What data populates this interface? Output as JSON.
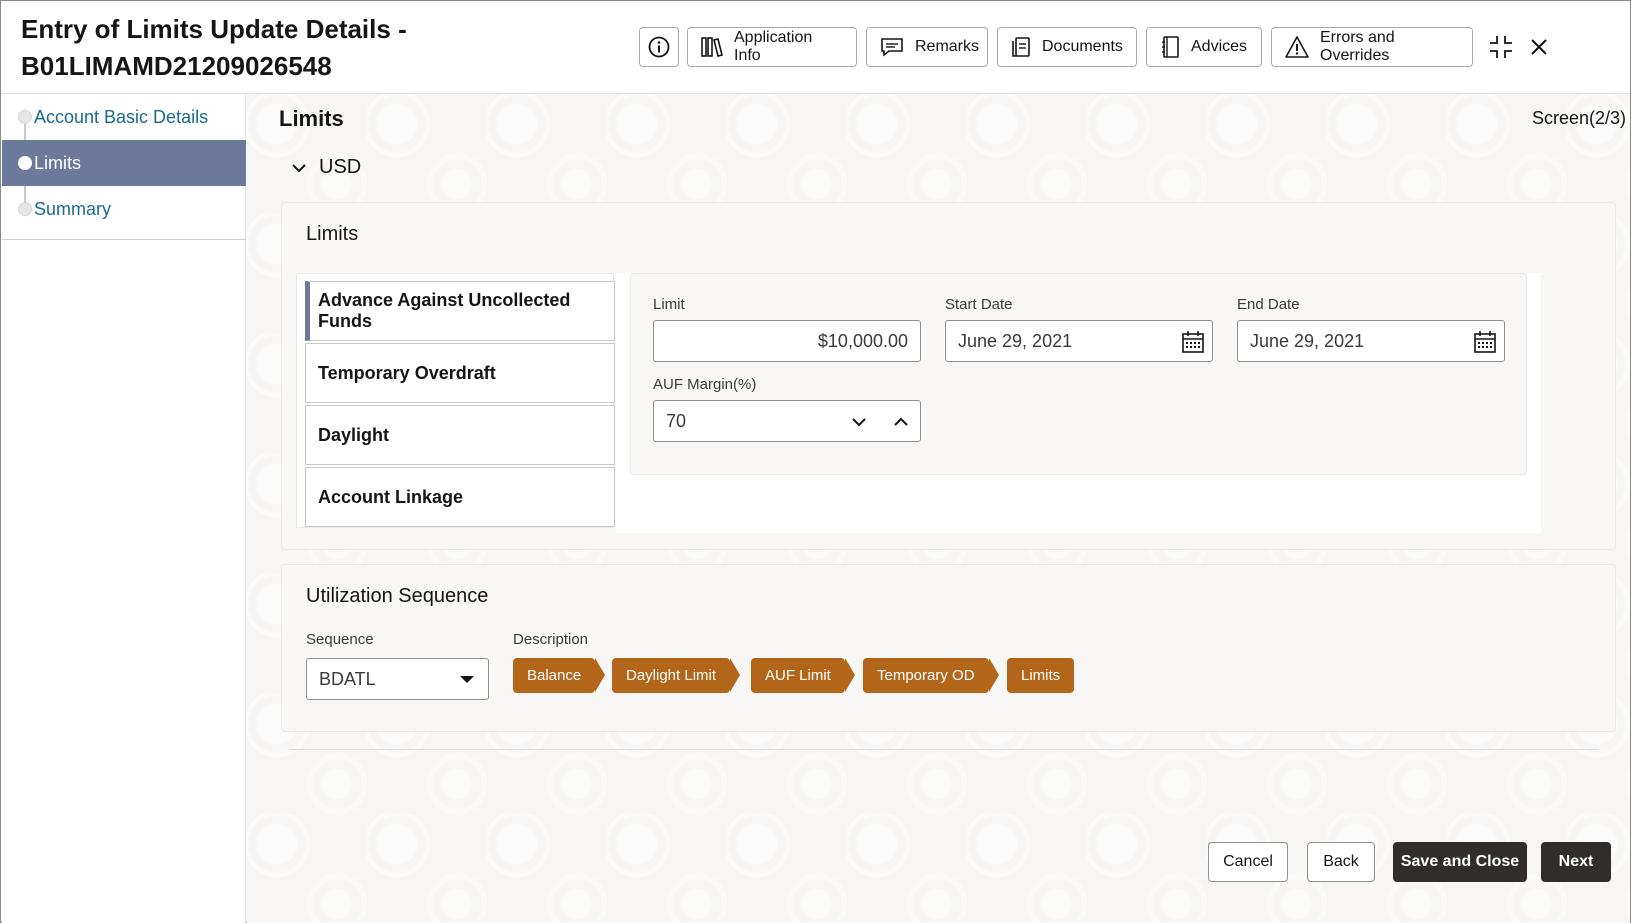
{
  "header": {
    "title_line1": "Entry of Limits Update Details -",
    "title_line2": "B01LIMAMD21209026548",
    "buttons": {
      "application_info": "Application Info",
      "remarks": "Remarks",
      "documents": "Documents",
      "advices": "Advices",
      "errors_overrides": "Errors and Overrides"
    },
    "icons": [
      "info-icon",
      "application-info-icon",
      "remarks-icon",
      "documents-icon",
      "advices-icon",
      "warning-icon",
      "collapse-icon",
      "close-icon"
    ]
  },
  "sidebar": {
    "items": [
      {
        "label": "Account Basic Details",
        "active": false
      },
      {
        "label": "Limits",
        "active": true
      },
      {
        "label": "Summary",
        "active": false
      }
    ]
  },
  "main": {
    "title": "Limits",
    "screen_indicator": "Screen(2/3)",
    "currency_section": "USD",
    "limits_panel": {
      "title": "Limits",
      "types": [
        "Advance Against Uncollected Funds",
        "Temporary Overdraft",
        "Daylight",
        "Account Linkage"
      ],
      "active_type": "Advance Against Uncollected Funds",
      "fields": {
        "limit_label": "Limit",
        "limit_value": "$10,000.00",
        "start_date_label": "Start Date",
        "start_date_value": "June 29, 2021",
        "end_date_label": "End Date",
        "end_date_value": "June 29, 2021",
        "auf_margin_label": "AUF Margin(%)",
        "auf_margin_value": "70"
      }
    },
    "utilization": {
      "title": "Utilization Sequence",
      "sequence_label": "Sequence",
      "sequence_value": "BDATL",
      "description_label": "Description",
      "chips": [
        "Balance",
        "Daylight Limit",
        "AUF Limit",
        "Temporary OD",
        "Limits"
      ]
    }
  },
  "footer": {
    "cancel": "Cancel",
    "back": "Back",
    "save_close": "Save and Close",
    "next": "Next"
  },
  "colors": {
    "accent_nav": "#6b7a9a",
    "chip": "#b3651a",
    "primary_button": "#312d2a",
    "link": "#1b6a8f"
  }
}
